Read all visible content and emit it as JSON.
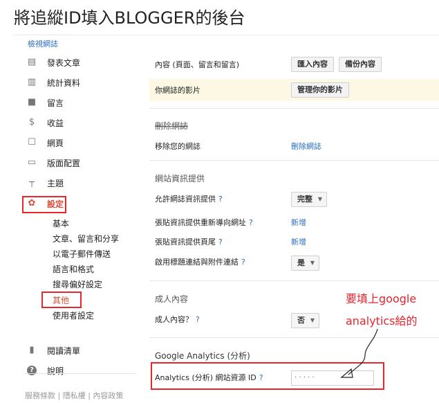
{
  "page_title": "將追縱ID填入BLOGGER的後台",
  "sidebar": {
    "view_blog": "檢視網誌",
    "items": [
      {
        "icon": "posts-icon",
        "glyph": "▤",
        "label": "發表文章"
      },
      {
        "icon": "stats-icon",
        "glyph": "▥",
        "label": "統計資料"
      },
      {
        "icon": "comments-icon",
        "glyph": "■",
        "label": "留言"
      },
      {
        "icon": "earnings-icon",
        "glyph": "$",
        "label": "收益"
      },
      {
        "icon": "pages-icon",
        "glyph": "☐",
        "label": "網頁"
      },
      {
        "icon": "layout-icon",
        "glyph": "▭",
        "label": "版面配置"
      },
      {
        "icon": "theme-icon",
        "glyph": "┬",
        "label": "主題"
      },
      {
        "icon": "settings-gear-icon",
        "glyph": "✿",
        "label": "設定"
      }
    ],
    "settings_sub": [
      "基本",
      "文章、留言和分享",
      "以電子郵件傳送",
      "語言和格式",
      "搜尋偏好設定",
      "其他",
      "使用者設定"
    ],
    "bottom_items": [
      {
        "icon": "reading-list-icon",
        "glyph": "▮",
        "label": "閱讀清單"
      },
      {
        "icon": "help-icon",
        "glyph": "?",
        "label": "說明"
      }
    ],
    "footer": "服務條款 | 隱私權 | 內容政策"
  },
  "content": {
    "content_row_label": "內容 (頁面、留言和留言)",
    "import_button": "匯入內容",
    "backup_button": "備份內容",
    "videos_row_label": "你網誌的影片",
    "manage_videos_button": "管理你的影片",
    "delete_section": "刪除網誌",
    "delete_row_label": "移除您的網誌",
    "delete_link": "刪除網誌",
    "feed_section": "網站資訊提供",
    "allow_feed_label": "允許網誌資訊提供",
    "allow_feed_value": "完整",
    "redirect_label": "張貼資訊提供重新導向網址",
    "redirect_link": "新增",
    "footer_label": "張貼資訊提供頁尾",
    "footer_link": "新增",
    "enclosure_label": "啟用標題連結與附件連結",
    "enclosure_value": "是",
    "adult_section": "成人內容",
    "adult_label": "成人內容？",
    "adult_value": "否",
    "ga_section": "Google Analytics (分析)",
    "ga_label": "Analytics (分析) 網站資源 ID",
    "ga_input_value": "· · · · ·",
    "help_mark": "?"
  },
  "annotation": {
    "line1": "要填上google",
    "line2": "analytics給的"
  },
  "colors": {
    "highlight_red": "#e8242c",
    "link_blue": "#2b6bbf",
    "active_orange": "#dd4b39",
    "video_row_bg": "#fcf8e3"
  }
}
